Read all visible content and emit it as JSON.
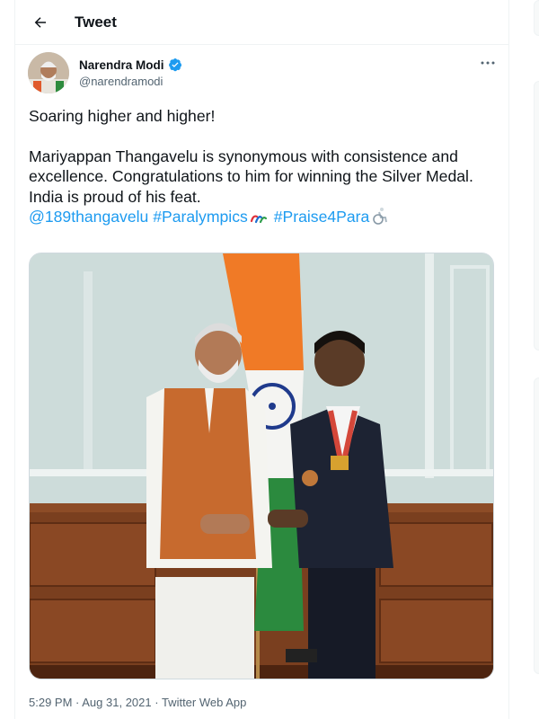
{
  "header": {
    "title": "Tweet"
  },
  "author": {
    "display_name": "Narendra Modi",
    "handle": "@narendramodi",
    "verified": true
  },
  "tweet": {
    "line1": "Soaring higher and higher!",
    "body": "Mariyappan Thangavelu is synonymous with consistence and excellence. Congratulations to him for winning the Silver Medal. India is proud of his feat.",
    "mention": "@189thangavelu",
    "hashtag1": "#Paralympics",
    "hashtag2": "#Praise4Para"
  },
  "meta": {
    "time": "5:29 PM",
    "sep1": " · ",
    "date": "Aug 31, 2021",
    "sep2": " · ",
    "source": "Twitter Web App"
  },
  "colors": {
    "accent": "#1d9bf0",
    "text": "#0f1419",
    "secondary": "#536471",
    "border": "#eff3f4"
  },
  "icons": {
    "back": "arrow-left-icon",
    "verified": "verified-badge-icon",
    "more": "more-dots-icon",
    "emoji1": "paralympics-agitos-emoji",
    "emoji2": "wheelchair-emoji"
  }
}
